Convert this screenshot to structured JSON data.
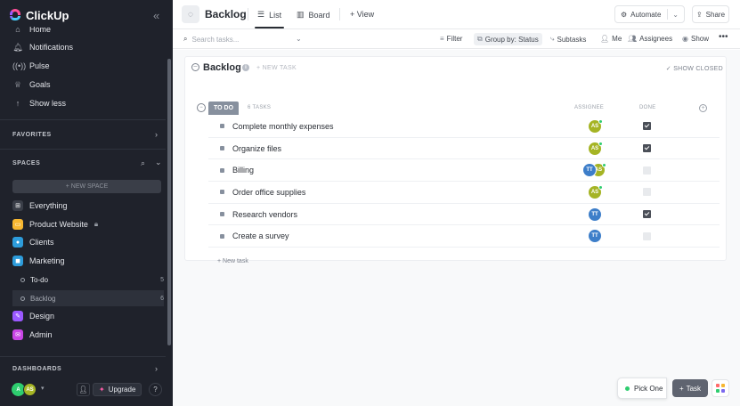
{
  "app": {
    "name": "ClickUp"
  },
  "sidebar": {
    "nav": [
      {
        "label": "Home",
        "icon": "home-icon"
      },
      {
        "label": "Notifications",
        "icon": "bell-icon"
      },
      {
        "label": "Pulse",
        "icon": "pulse-icon"
      },
      {
        "label": "Goals",
        "icon": "trophy-icon"
      },
      {
        "label": "Show less",
        "icon": "arrow-up-icon"
      }
    ],
    "favorites_label": "FAVORITES",
    "spaces_label": "SPACES",
    "new_space_label": "+ NEW SPACE",
    "spaces": [
      {
        "label": "Everything",
        "color": "#5c616c",
        "glyph": "⊞"
      },
      {
        "label": "Product Website",
        "color": "#f7b731",
        "glyph": "▭",
        "locked": true
      },
      {
        "label": "Clients",
        "color": "#2d9cdb",
        "glyph": "●"
      },
      {
        "label": "Marketing",
        "color": "#2d9cdb",
        "glyph": "◼"
      }
    ],
    "lists": [
      {
        "label": "To-do",
        "count": "5"
      },
      {
        "label": "Backlog",
        "count": "6"
      }
    ],
    "spaces_after": [
      {
        "label": "Design",
        "color": "#9b59ff",
        "glyph": "✎"
      },
      {
        "label": "Admin",
        "color": "#c946e6",
        "glyph": "✉"
      }
    ],
    "dashboards_label": "DASHBOARDS",
    "user_initials_a": "A",
    "user_initials_b": "AS",
    "upgrade_label": "Upgrade"
  },
  "topbar": {
    "title": "Backlog",
    "tabs": [
      {
        "label": "List"
      },
      {
        "label": "Board"
      }
    ],
    "add_view_label": "+ View",
    "automate_label": "Automate",
    "share_label": "Share"
  },
  "filterbar": {
    "search_placeholder": "Search tasks...",
    "filter_label": "Filter",
    "group_by_label": "Group by: Status",
    "subtasks_label": "Subtasks",
    "me_label": "Me",
    "assignees_label": "Assignees",
    "show_label": "Show"
  },
  "list": {
    "title": "Backlog",
    "new_task_label": "+ NEW TASK",
    "show_closed_label": "SHOW CLOSED",
    "group": {
      "status": "TO DO",
      "task_count": "6 TASKS",
      "col_assignee": "ASSIGNEE",
      "col_done": "DONE"
    },
    "tasks": [
      {
        "name": "Complete monthly expenses",
        "assignees": [
          {
            "initials": "AS",
            "color": "#a5b424",
            "online": true
          }
        ],
        "done": true
      },
      {
        "name": "Organize files",
        "assignees": [
          {
            "initials": "AS",
            "color": "#a5b424",
            "online": true
          }
        ],
        "done": true
      },
      {
        "name": "Billing",
        "assignees": [
          {
            "initials": "TT",
            "color": "#3d7ec9",
            "online": false
          },
          {
            "initials": "AS",
            "color": "#a5b424",
            "online": true
          }
        ],
        "done": false
      },
      {
        "name": "Order office supplies",
        "assignees": [
          {
            "initials": "AS",
            "color": "#a5b424",
            "online": true
          }
        ],
        "done": false
      },
      {
        "name": "Research vendors",
        "assignees": [
          {
            "initials": "TT",
            "color": "#3d7ec9",
            "online": false
          }
        ],
        "done": true
      },
      {
        "name": "Create a survey",
        "assignees": [
          {
            "initials": "TT",
            "color": "#3d7ec9",
            "online": false
          }
        ],
        "done": false
      }
    ],
    "new_task_bottom_label": "+ New task"
  },
  "floating": {
    "pick_label": "Pick One",
    "task_label": "Task",
    "grid_colors": [
      "#ff6b6b",
      "#f7b731",
      "#2ecd6f",
      "#7b68ee"
    ]
  }
}
